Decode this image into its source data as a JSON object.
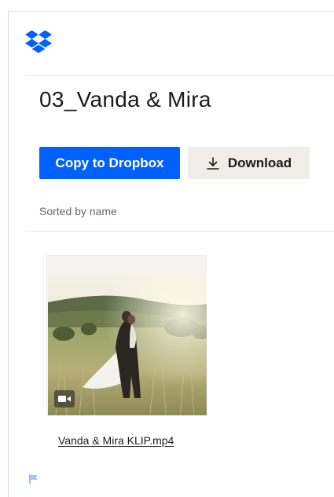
{
  "header": {
    "logo_icon": "dropbox-logo-icon",
    "brand_color": "#0061fe"
  },
  "folder": {
    "title": "03_Vanda & Mira"
  },
  "actions": {
    "copy_label": "Copy to Dropbox",
    "download_label": "Download",
    "download_icon": "download-icon"
  },
  "listing": {
    "sort_label": "Sorted by name"
  },
  "files": [
    {
      "name": "Vanda & Mira KLIP.mp4",
      "type_icon": "video-camera-icon"
    }
  ],
  "footer": {
    "icon": "flag-icon"
  }
}
